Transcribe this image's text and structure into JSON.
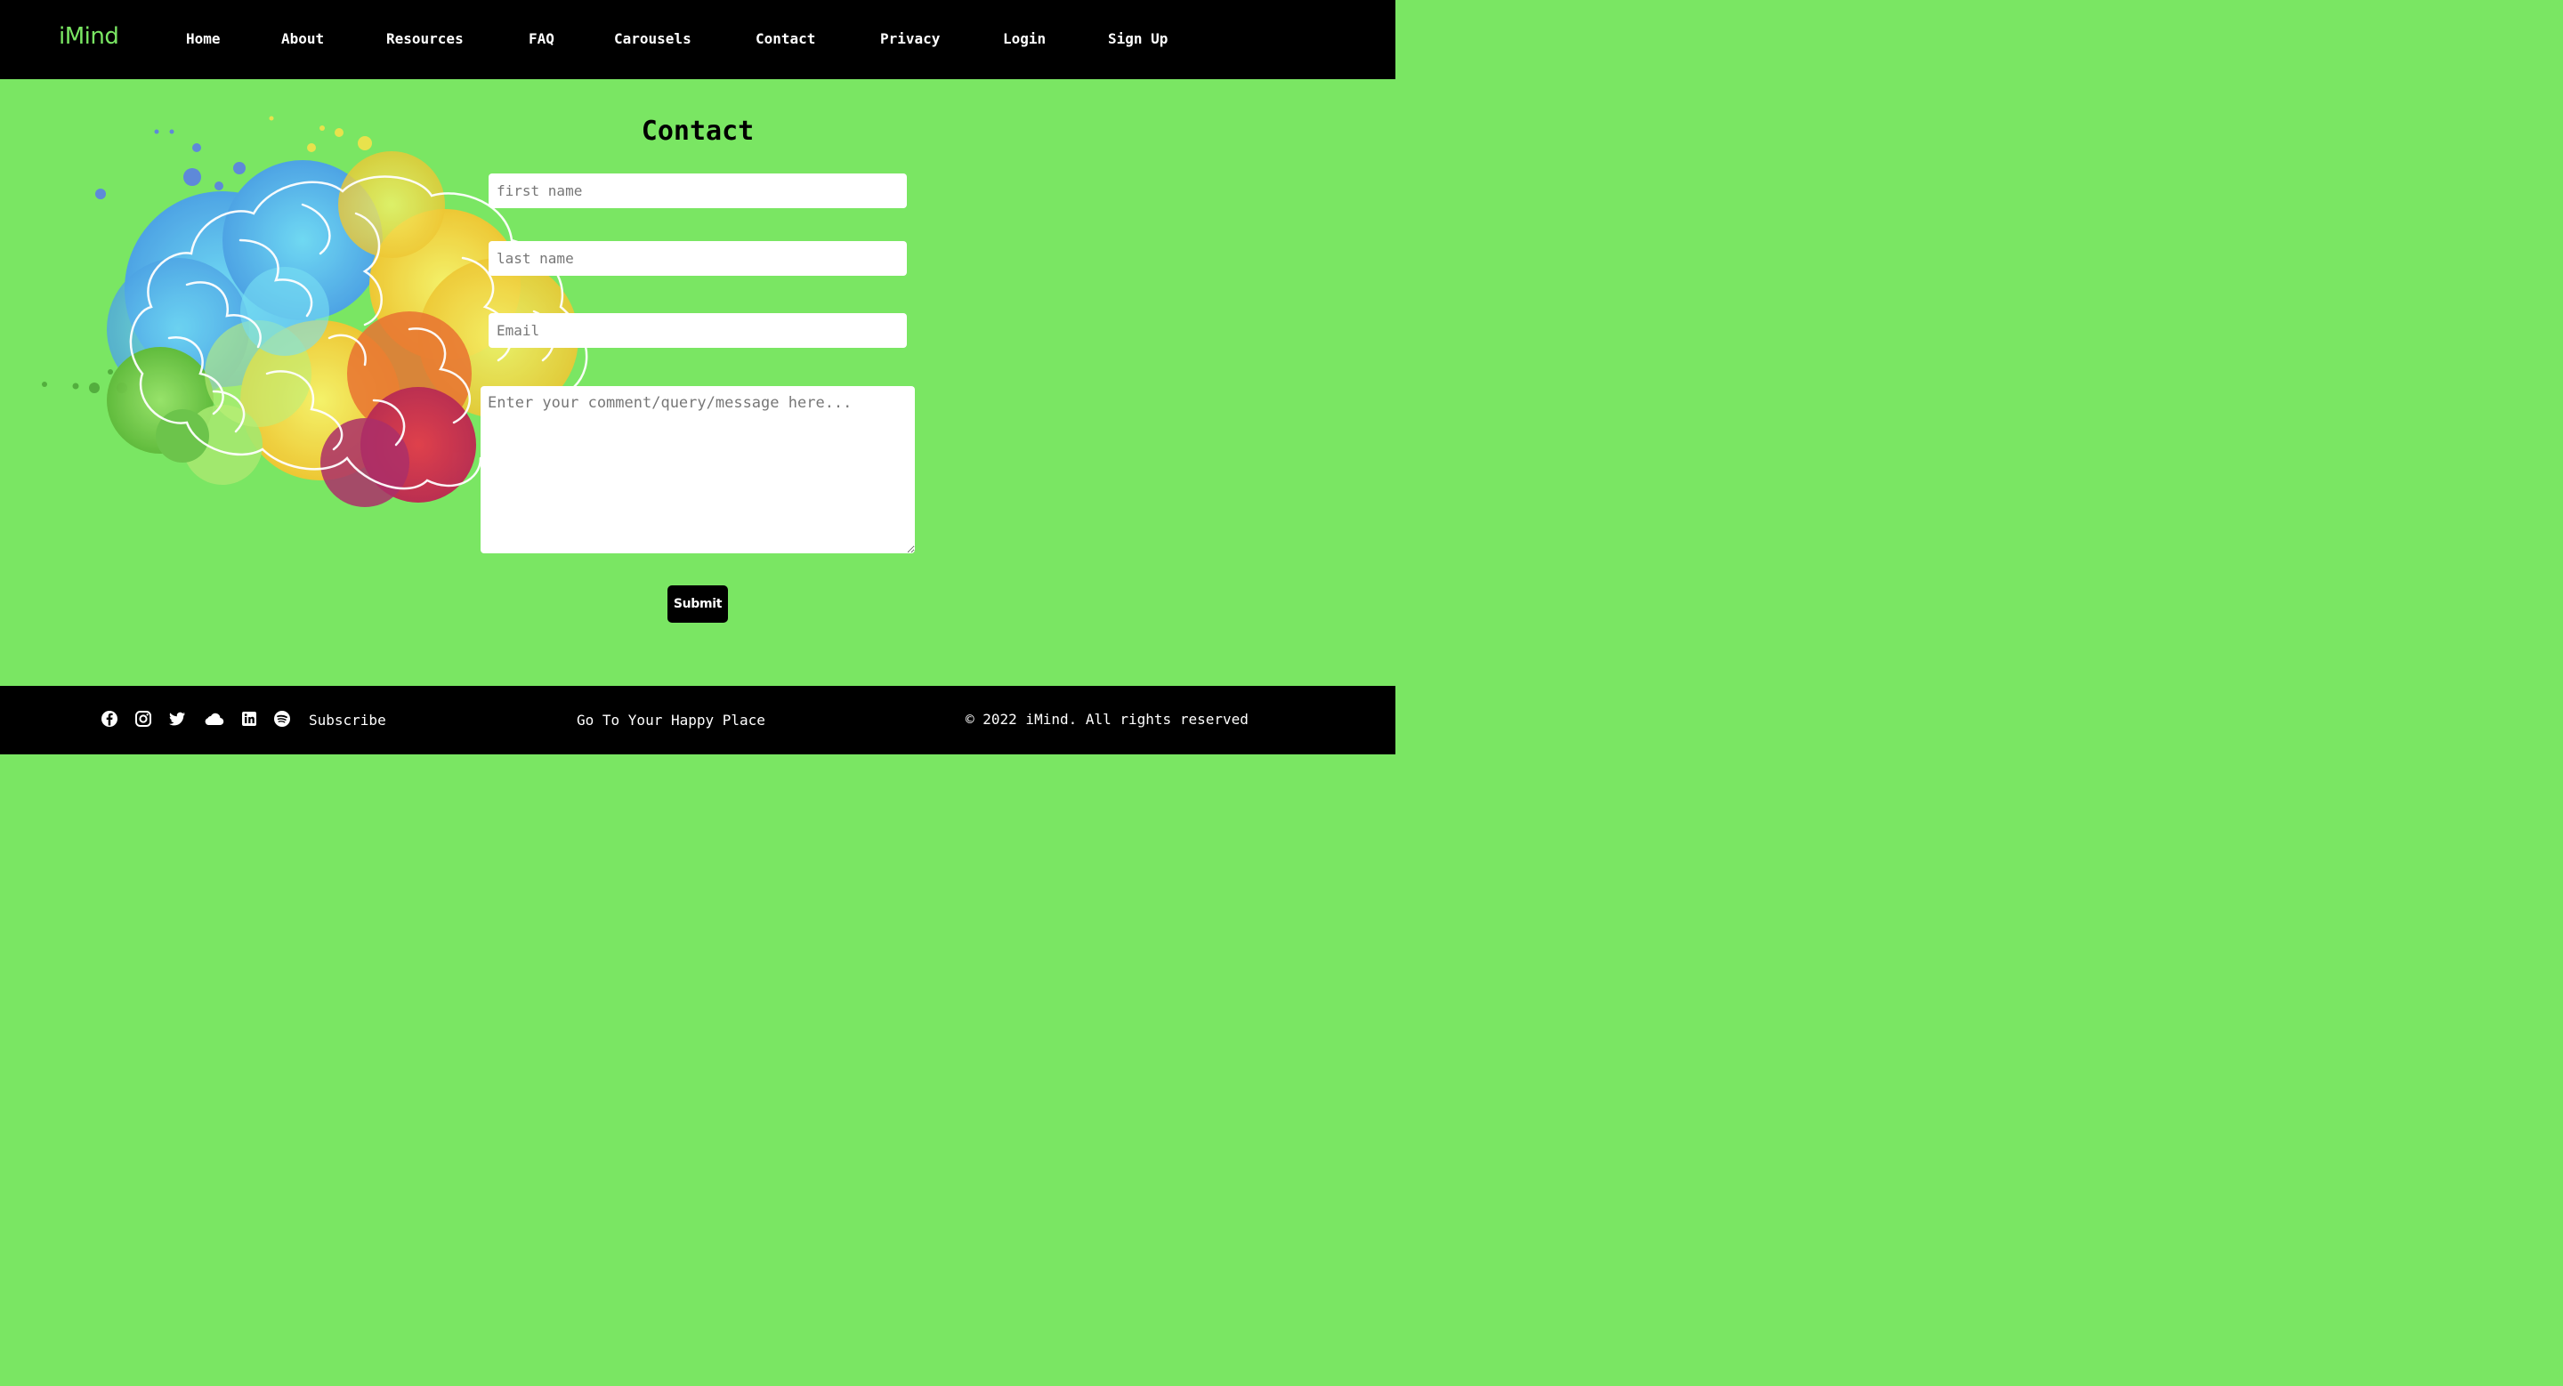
{
  "brand": {
    "logo_text": "iMind",
    "logo_color": "#7ae663"
  },
  "nav": {
    "items": [
      {
        "label": "Home"
      },
      {
        "label": "About"
      },
      {
        "label": "Resources"
      },
      {
        "label": "FAQ"
      },
      {
        "label": "Carousels"
      },
      {
        "label": "Contact"
      },
      {
        "label": "Privacy"
      },
      {
        "label": "Login"
      },
      {
        "label": "Sign Up"
      }
    ]
  },
  "contact": {
    "title": "Contact",
    "first_name": {
      "value": "",
      "placeholder": "first name"
    },
    "last_name": {
      "value": "",
      "placeholder": "last name"
    },
    "email": {
      "value": "",
      "placeholder": "Email"
    },
    "message": {
      "value": "",
      "placeholder": "Enter your comment/query/message here..."
    },
    "submit_label": "Submit"
  },
  "footer": {
    "social_icons": [
      "facebook-icon",
      "instagram-icon",
      "twitter-icon",
      "cloud-icon",
      "linkedin-icon",
      "spotify-icon"
    ],
    "subscribe_label": "Subscribe",
    "tagline": "Go To Your Happy Place",
    "copyright": "© 2022 iMind. All rights reserved"
  },
  "colors": {
    "background": "#7ae663",
    "header_footer": "#000000",
    "accent": "#7ae663"
  }
}
